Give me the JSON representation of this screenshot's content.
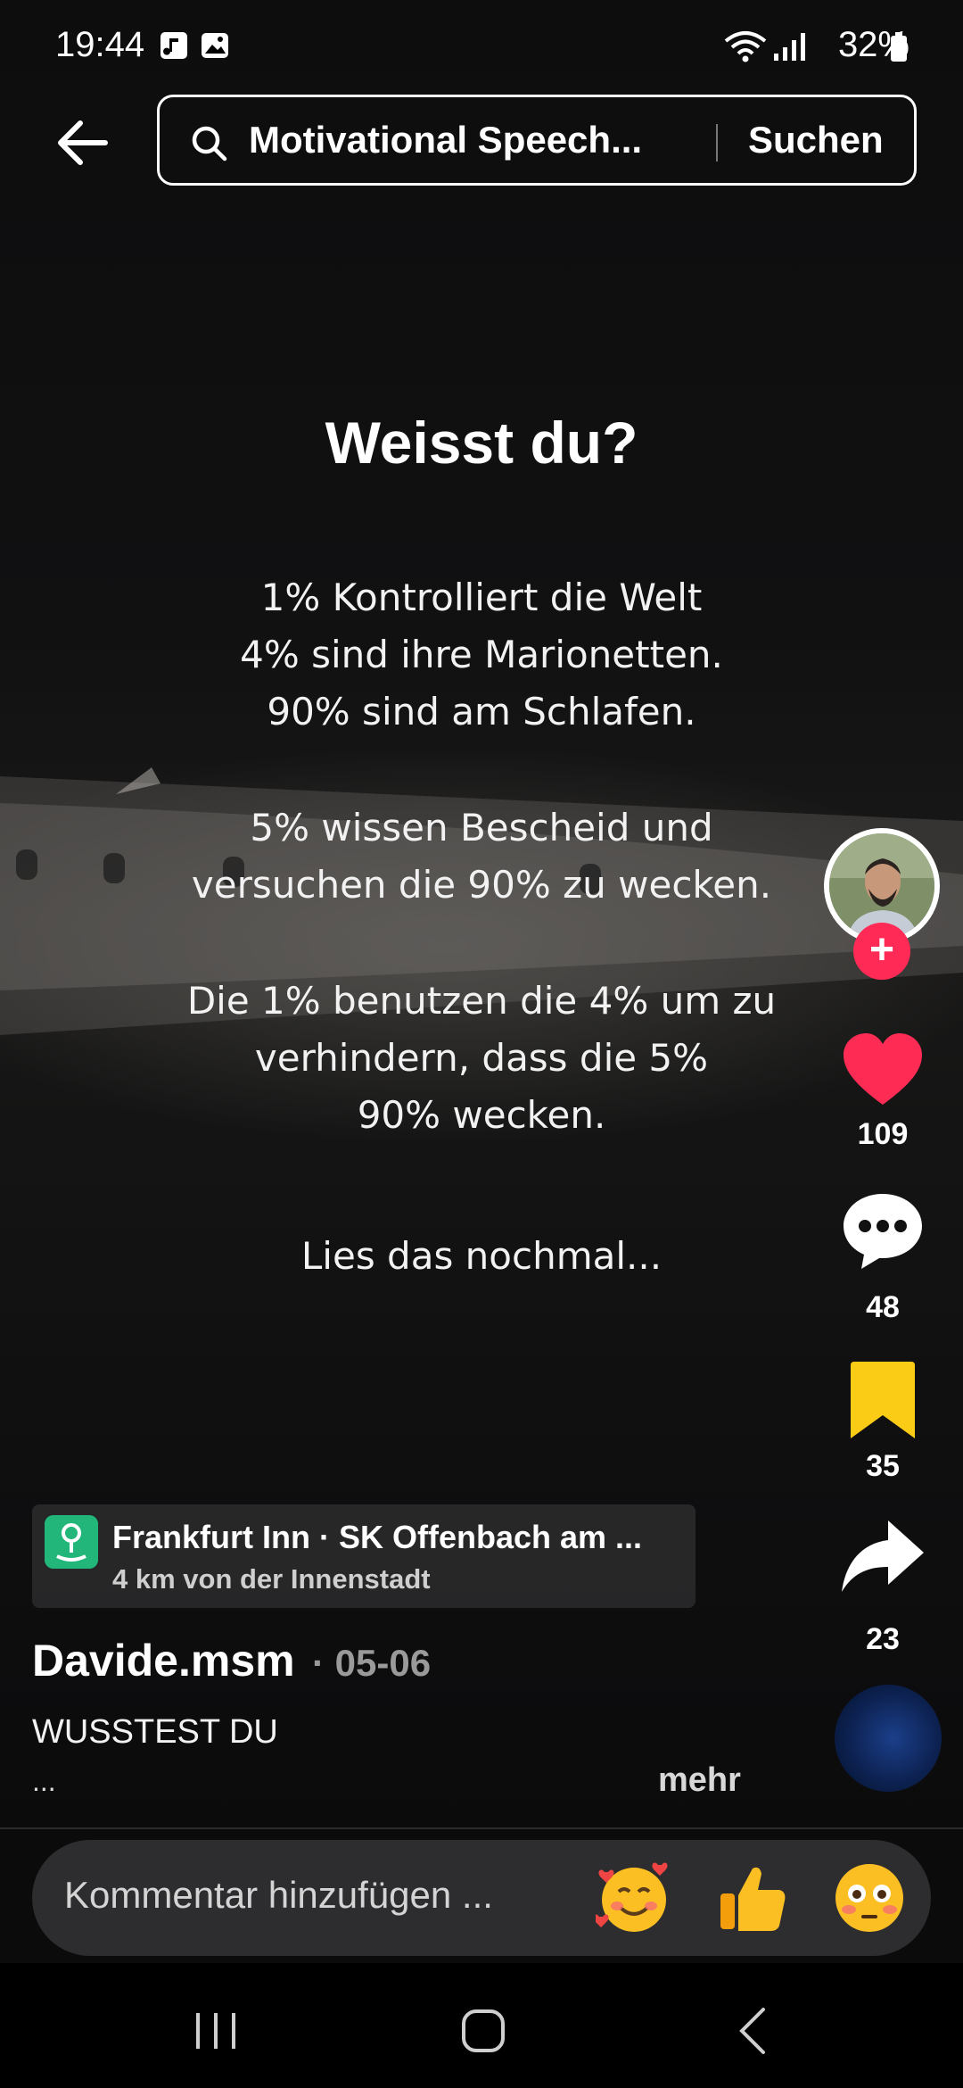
{
  "status_bar": {
    "time": "19:44",
    "battery": "32%",
    "icons": [
      "music-notification-icon",
      "gallery-notification-icon",
      "wifi-icon",
      "signal-icon",
      "battery-icon"
    ]
  },
  "header": {
    "search_query": "Motivational Speech...",
    "search_button": "Suchen"
  },
  "video": {
    "headline": "Weisst du?",
    "lines": [
      "1% Kontrolliert die Welt",
      "4% sind ihre Marionetten.",
      "90% sind am Schlafen.",
      "5% wissen Bescheid und",
      "versuchen die 90% zu wecken.",
      "Die 1% benutzen die 4% um zu",
      "verhindern, dass die 5%",
      "90% wecken.",
      "Lies das nochmal..."
    ]
  },
  "actions": {
    "likes": "109",
    "comments": "48",
    "saves": "35",
    "shares": "23",
    "like_color": "#fe2c55",
    "save_color": "#facc15"
  },
  "location": {
    "name": "Frankfurt Inn · SK Offenbach am ...",
    "distance": "4 km von der Innenstadt"
  },
  "post": {
    "author": "Davide.msm",
    "date": "· 05-06",
    "caption": "WUSSTEST DU",
    "ellipsis": "...",
    "more": "mehr"
  },
  "comment_bar": {
    "placeholder": "Kommentar hinzufügen ...",
    "emojis": [
      "smiling-face-with-hearts",
      "thumbs-up",
      "flushed-face"
    ]
  }
}
